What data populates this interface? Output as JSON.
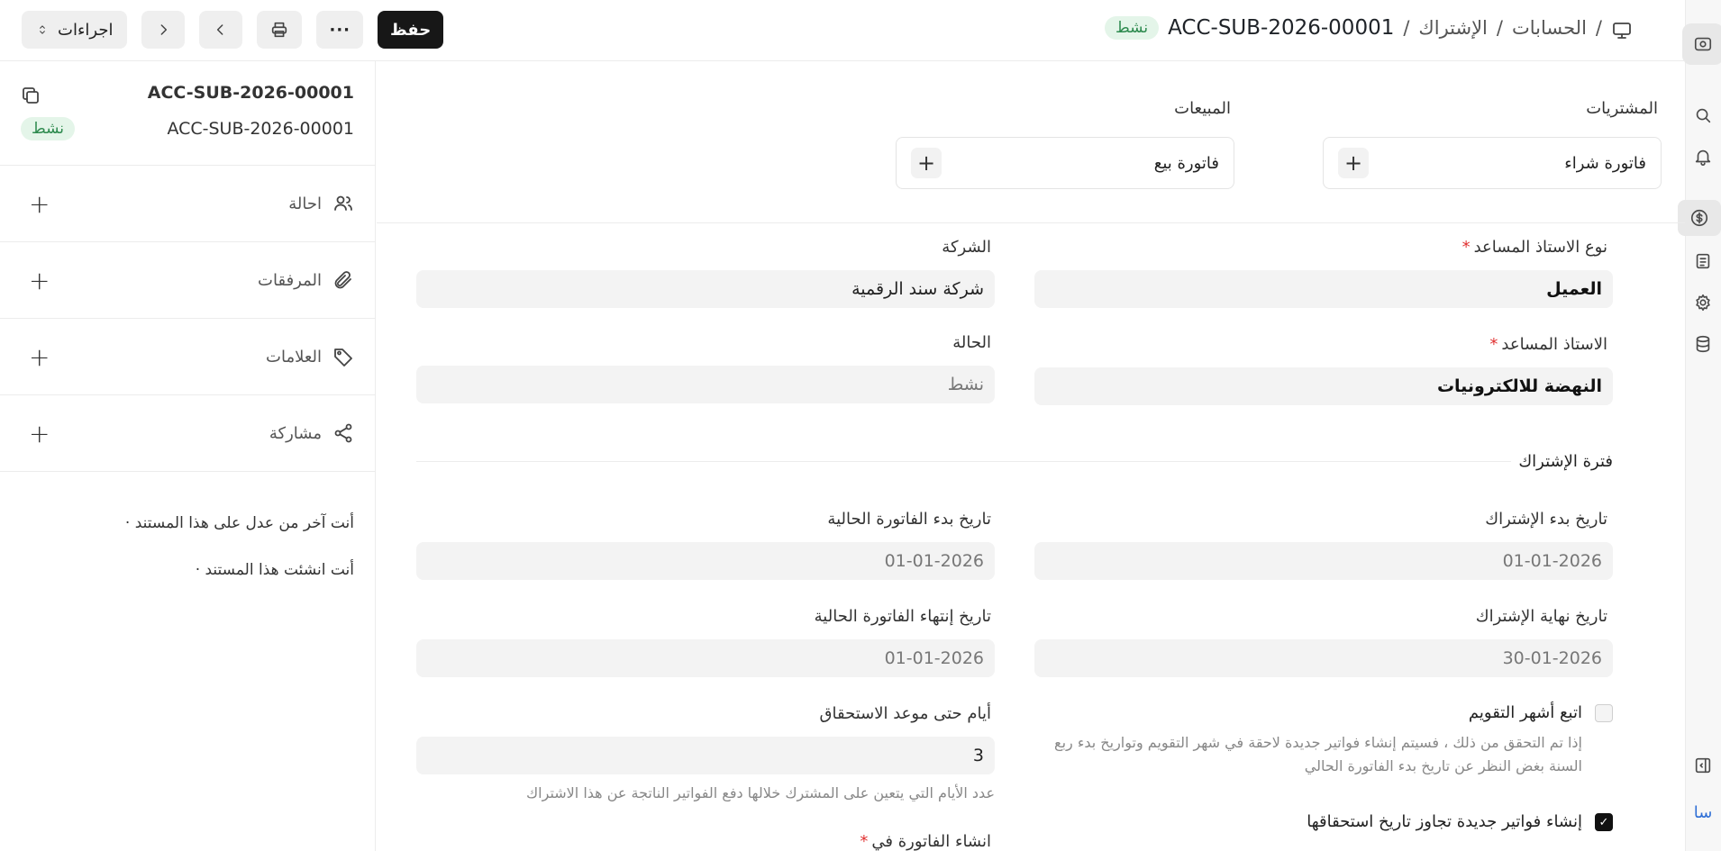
{
  "topbar": {
    "breadcrumb": [
      "الحسابات",
      "الإشتراك"
    ],
    "separator": "/",
    "doc_id": "ACC-SUB-2026-00001",
    "status": "نشط",
    "actions_label": "اجراءات",
    "save_label": "حفظ",
    "more_label": "···"
  },
  "sidebar": {
    "name": "ACC-SUB-2026-00001",
    "sub": "ACC-SUB-2026-00001",
    "status": "نشط",
    "items": [
      {
        "label": "احالة",
        "icon": "users-icon"
      },
      {
        "label": "المرفقات",
        "icon": "paperclip-icon"
      },
      {
        "label": "العلامات",
        "icon": "tag-icon"
      },
      {
        "label": "مشاركة",
        "icon": "share-icon"
      }
    ],
    "activity": [
      "أنت آخر من عدل على هذا المستند ·",
      "أنت انشئت هذا المستند ·"
    ]
  },
  "connections": {
    "purchases": {
      "title": "المشتريات",
      "item": "فاتورة شراء"
    },
    "sales": {
      "title": "المبيعات",
      "item": "فاتورة بيع"
    }
  },
  "form": {
    "party_type_label": "نوع الاستاذ المساعد",
    "party_type_value": "العميل",
    "company_label": "الشركة",
    "company_value": "شركة سند الرقمية",
    "party_label": "الاستاذ المساعد",
    "party_value": "النهضة للالكترونيات",
    "status_label": "الحالة",
    "status_value": "نشط",
    "section_period": "فترة الإشتراك",
    "start_label": "تاريخ بدء الإشتراك",
    "start_value": "01-01-2026",
    "inv_start_label": "تاريخ بدء الفاتورة الحالية",
    "inv_start_value": "01-01-2026",
    "end_label": "تاريخ نهاية الإشتراك",
    "end_value": "30-01-2026",
    "inv_end_label": "تاريخ إنتهاء الفاتورة الحالية",
    "inv_end_value": "01-01-2026",
    "follow_months_label": "اتبع أشهر التقويم",
    "follow_months_help_1": "إذا تم التحقق من ذلك ، فسيتم إنشاء فواتير جديدة لاحقة في شهر التقويم وتواريخ بدء ربع",
    "follow_months_help_2": "السنة بغض النظر عن تاريخ بدء الفاتورة الحالي",
    "days_due_label": "أيام حتى موعد الاستحقاق",
    "days_due_value": "3",
    "days_due_help": "عدد الأيام التي يتعين على المشترك خلالها دفع الفواتير الناتجة عن هذا الاشتراك",
    "generate_new_label": "إنشاء فواتير جديدة تجاوز تاريخ استحقاقها",
    "generate_at_label": "انشاء الفاتورة في"
  },
  "rail": {
    "user_initials": "سا"
  }
}
